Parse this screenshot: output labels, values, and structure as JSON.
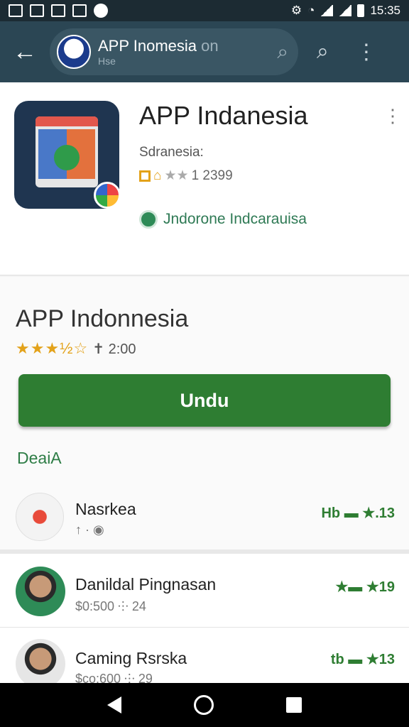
{
  "status_bar": {
    "time": "15:35"
  },
  "app_bar": {
    "title": "APP Inomesia",
    "title_suffix": "on",
    "subtitle": "Hse"
  },
  "header": {
    "title": "APP Indanesia",
    "subtitle": "Sdranesia:",
    "rating_count": "1 2399",
    "developer": "Jndorone Indcarauisa"
  },
  "detail": {
    "title": "APP Indonnesia",
    "stars": "★★★½☆",
    "downloads": "✝ 2:00",
    "install_label": "Undu",
    "section_label": "DeaiA"
  },
  "list": [
    {
      "name": "Nasrkea",
      "meta": "↑ · ◉",
      "badge": "Hb ▬ ★.13"
    },
    {
      "name": "Danildal Pingnasan",
      "meta": "$0:500 ⸭ 24",
      "badge": "★▬ ★19"
    },
    {
      "name": "Caming Rsrska",
      "meta": "$co:600 ⸭ 29",
      "badge": "tb ▬ ★13"
    }
  ],
  "colors": {
    "accent": "#2e7d32",
    "app_bar": "#2b4654",
    "status_bar": "#1c2b33"
  }
}
